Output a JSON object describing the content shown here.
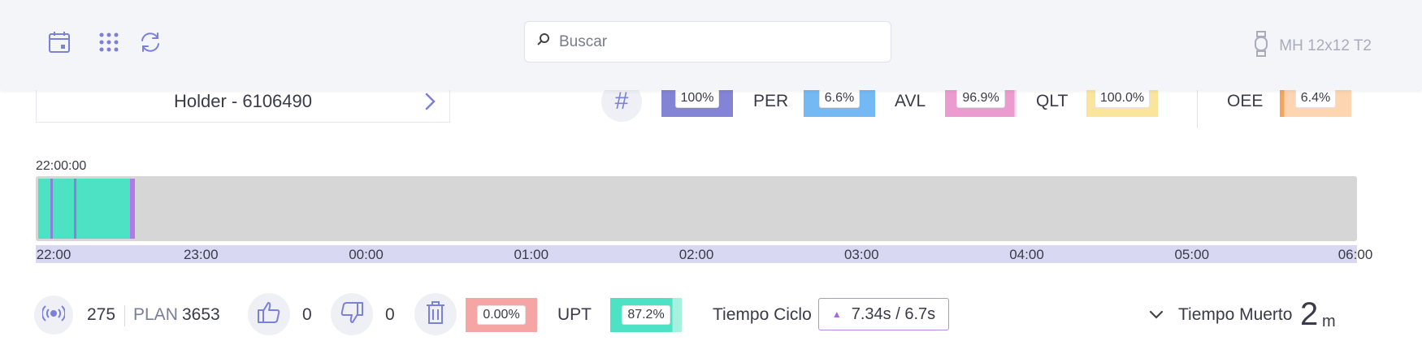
{
  "colors": {
    "accent": "#7b80d8",
    "kpi_base": "#8384d6",
    "kpi_per": "#74b9f4",
    "kpi_avl": "#ec9bd0",
    "kpi_qlt": "#fbe59c",
    "kpi_oee": "#fdd5b0",
    "timeline_run": "#4ee2c4",
    "timeline_idle": "#d6d6d6",
    "timeline_marker": "#8c80d8",
    "timeline_end": "#b27ae8",
    "quality_chip": "#f6a5a5",
    "upt_chip": "#4ee2c4"
  },
  "topbar": {
    "icons": [
      "calendar-icon",
      "apps-grid-icon",
      "refresh-icon"
    ],
    "search": {
      "placeholder": "Buscar",
      "value": ""
    },
    "machine_icon": "watch-icon",
    "machine_name": "MH 12x12 T2"
  },
  "holder": {
    "label": "Holder - 6106490",
    "icon": "chevron-right-icon"
  },
  "kpis": {
    "hash_symbol": "#",
    "base": {
      "label": "",
      "value": "100%",
      "fraction": 1.0
    },
    "per": {
      "label": "PER",
      "value": "6.6%",
      "fraction": 0.066
    },
    "avl": {
      "label": "AVL",
      "value": "96.9%",
      "fraction": 0.969
    },
    "qlt": {
      "label": "QLT",
      "value": "100.0%",
      "fraction": 1.0
    },
    "oee": {
      "label": "OEE",
      "value": "6.4%",
      "fraction": 0.064
    }
  },
  "timeline": {
    "start_label": "22:00:00",
    "ticks": [
      "22:00",
      "23:00",
      "00:00",
      "01:00",
      "02:00",
      "03:00",
      "04:00",
      "05:00",
      "06:00"
    ],
    "run_end_hours": 0.57,
    "markers_hours": [
      0.09,
      0.23
    ],
    "end_marker_hours": 0.59,
    "total_hours": 8
  },
  "bottom": {
    "count": "275",
    "plan_label": "PLAN",
    "plan_value": "3653",
    "good_count": "0",
    "bad_count": "0",
    "quality_pct": "0.00%",
    "upt_label": "UPT",
    "upt_value": "87.2%",
    "upt_fraction": 0.872,
    "cycle_label": "Tiempo Ciclo",
    "cycle_actual": "7.34s",
    "cycle_sep": "/",
    "cycle_target": "6.7s",
    "dead_time_label": "Tiempo Muerto",
    "dead_time_value": "2",
    "dead_time_unit": "m"
  }
}
